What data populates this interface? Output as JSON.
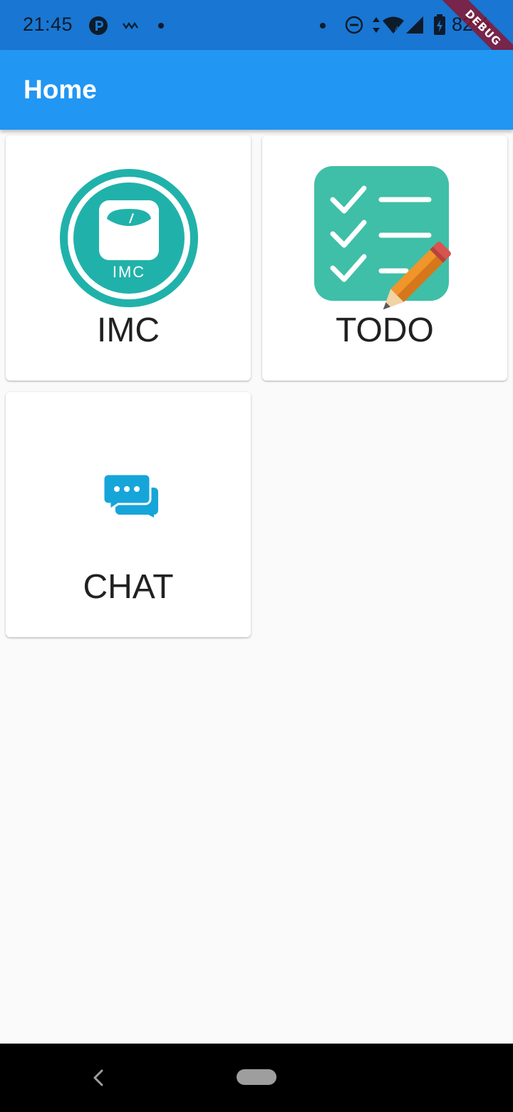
{
  "status_bar": {
    "time": "21:45",
    "battery": "82%",
    "icons": [
      "parking-icon",
      "signal-wave-icon",
      "notification-dot-icon",
      "dnd-icon",
      "wifi-icon",
      "cell-signal-icon",
      "battery-icon"
    ]
  },
  "debug_banner": "DEBUG",
  "app_bar": {
    "title": "Home"
  },
  "grid": {
    "items": [
      {
        "label": "IMC",
        "icon": "scale-icon",
        "accent": "#20b2aa"
      },
      {
        "label": "TODO",
        "icon": "checklist-icon",
        "accent": "#3fbfa7"
      },
      {
        "label": "CHAT",
        "icon": "chat-bubbles-icon",
        "accent": "#16a5d9"
      }
    ]
  },
  "scale_icon_text": "IMC",
  "colors": {
    "status_bar": "#1976d2",
    "app_bar": "#2196f3",
    "background": "#fafafa"
  }
}
